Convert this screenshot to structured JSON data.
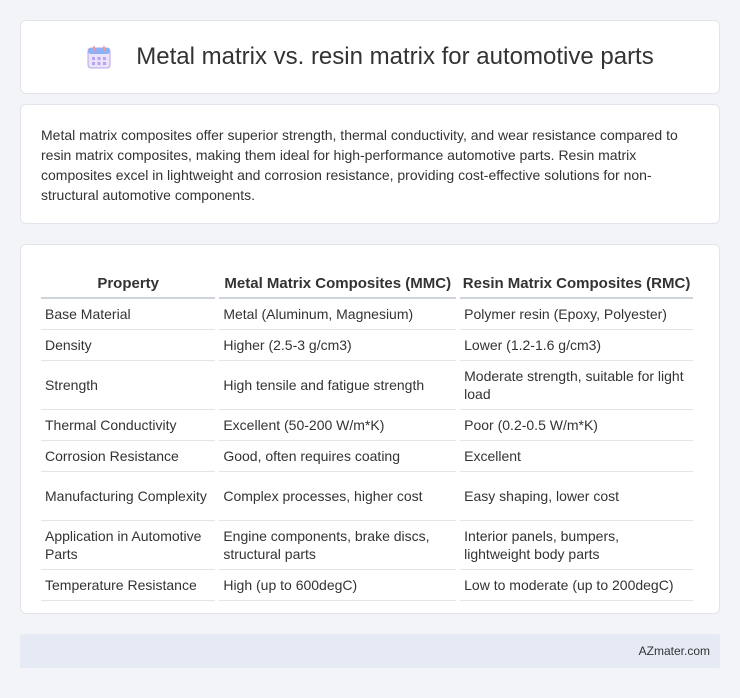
{
  "header": {
    "icon": "calendar-icon",
    "title": "Metal matrix vs. resin matrix for automotive parts"
  },
  "summary": {
    "text": "Metal matrix composites offer superior strength, thermal conductivity, and wear resistance compared to resin matrix composites, making them ideal for high-performance automotive parts. Resin matrix composites excel in lightweight and corrosion resistance, providing cost-effective solutions for non-structural automotive components."
  },
  "table": {
    "headers": [
      "Property",
      "Metal Matrix Composites (MMC)",
      "Resin Matrix Composites (RMC)"
    ],
    "rows": [
      [
        "Base Material",
        "Metal (Aluminum, Magnesium)",
        "Polymer resin (Epoxy, Polyester)"
      ],
      [
        "Density",
        "Higher (2.5-3 g/cm3)",
        "Lower (1.2-1.6 g/cm3)"
      ],
      [
        "Strength",
        "High tensile and fatigue strength",
        "Moderate strength, suitable for light load"
      ],
      [
        "Thermal Conductivity",
        "Excellent (50-200 W/m*K)",
        "Poor (0.2-0.5 W/m*K)"
      ],
      [
        "Corrosion Resistance",
        "Good, often requires coating",
        "Excellent"
      ],
      [
        "Manufacturing Complexity",
        "Complex processes, higher cost",
        "Easy shaping, lower cost"
      ],
      [
        "Application in Automotive Parts",
        "Engine components, brake discs, structural parts",
        "Interior panels, bumpers, lightweight body parts"
      ],
      [
        "Temperature Resistance",
        "High (up to 600degC)",
        "Low to moderate (up to 200degC)"
      ]
    ]
  },
  "footer": {
    "brand": "AZmater.com"
  }
}
